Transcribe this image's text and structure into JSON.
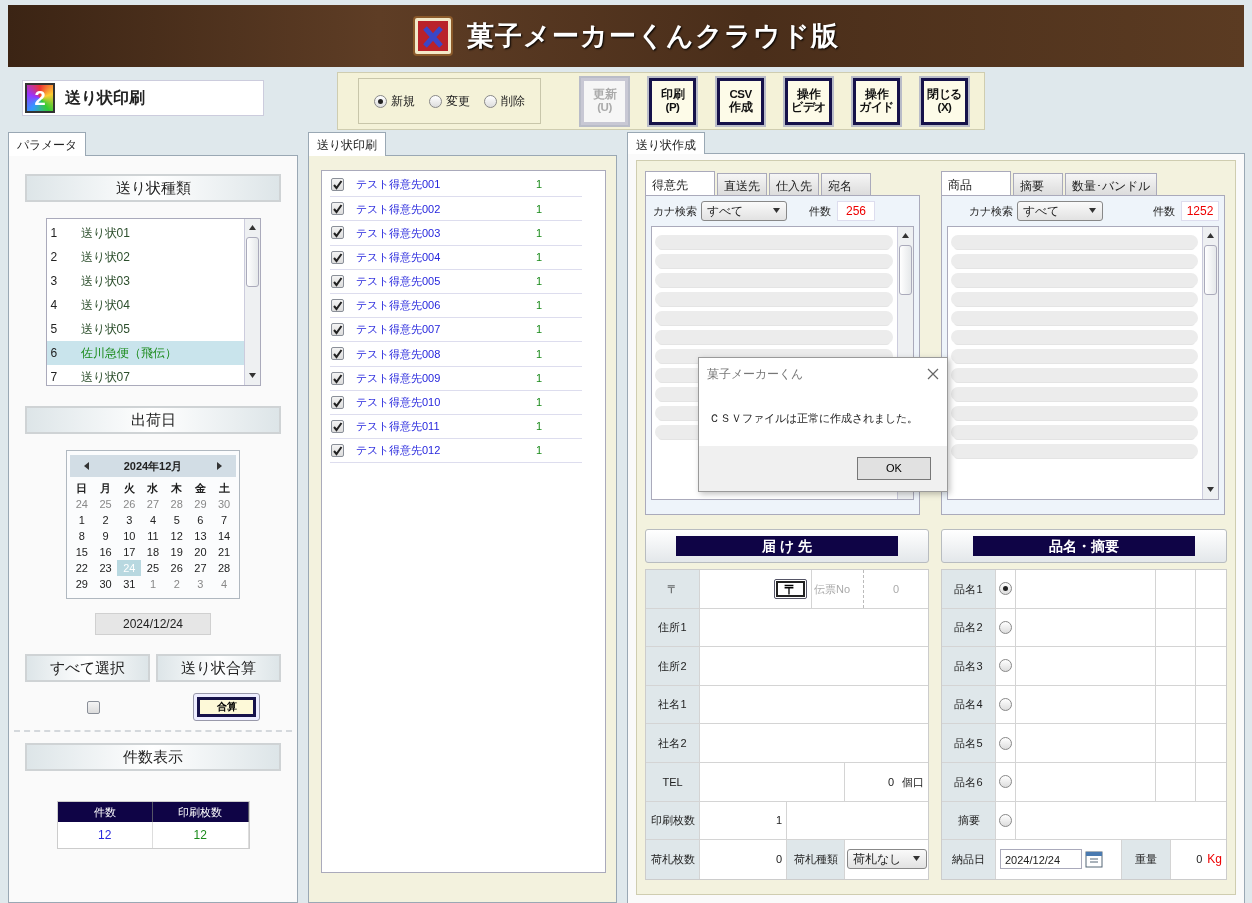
{
  "app_title": "菓子メーカーくんクラウド版",
  "screen_title": {
    "number": "2",
    "label": "送り状印刷"
  },
  "modes": [
    {
      "label": "新規",
      "selected": true
    },
    {
      "label": "変更",
      "selected": false
    },
    {
      "label": "削除",
      "selected": false
    }
  ],
  "toolbar_buttons": [
    {
      "lines": [
        "更新",
        "(U)"
      ],
      "disabled": true
    },
    {
      "lines": [
        "印刷",
        "(P)"
      ],
      "disabled": false
    },
    {
      "lines": [
        "CSV",
        "作成"
      ],
      "disabled": false
    },
    {
      "lines": [
        "操作",
        "ビデオ"
      ],
      "disabled": false
    },
    {
      "lines": [
        "操作",
        "ガイド"
      ],
      "disabled": false
    },
    {
      "lines": [
        "閉じる",
        "(X)"
      ],
      "disabled": false
    }
  ],
  "left_panel": {
    "tab": "パラメータ",
    "invoice_types": {
      "heading": "送り状種類",
      "items": [
        {
          "no": "1",
          "name": "送り状01",
          "selected": false
        },
        {
          "no": "2",
          "name": "送り状02",
          "selected": false
        },
        {
          "no": "3",
          "name": "送り状03",
          "selected": false
        },
        {
          "no": "4",
          "name": "送り状04",
          "selected": false
        },
        {
          "no": "5",
          "name": "送り状05",
          "selected": false
        },
        {
          "no": "6",
          "name": "佐川急便（飛伝）",
          "selected": true
        },
        {
          "no": "7",
          "name": "送り状07",
          "selected": false
        }
      ]
    },
    "ship_date": {
      "heading": "出荷日",
      "month": "2024年12月",
      "weekdays": [
        "日",
        "月",
        "火",
        "水",
        "木",
        "金",
        "土"
      ],
      "weeks": [
        [
          {
            "day": "24",
            "other_month": true,
            "selected": false
          },
          {
            "day": "25",
            "other_month": true,
            "selected": false
          },
          {
            "day": "26",
            "other_month": true,
            "selected": false
          },
          {
            "day": "27",
            "other_month": true,
            "selected": false
          },
          {
            "day": "28",
            "other_month": true,
            "selected": false
          },
          {
            "day": "29",
            "other_month": true,
            "selected": false
          },
          {
            "day": "30",
            "other_month": true,
            "selected": false
          }
        ],
        [
          {
            "day": "1",
            "other_month": false,
            "selected": false
          },
          {
            "day": "2",
            "other_month": false,
            "selected": false
          },
          {
            "day": "3",
            "other_month": false,
            "selected": false
          },
          {
            "day": "4",
            "other_month": false,
            "selected": false
          },
          {
            "day": "5",
            "other_month": false,
            "selected": false
          },
          {
            "day": "6",
            "other_month": false,
            "selected": false
          },
          {
            "day": "7",
            "other_month": false,
            "selected": false
          }
        ],
        [
          {
            "day": "8",
            "other_month": false,
            "selected": false
          },
          {
            "day": "9",
            "other_month": false,
            "selected": false
          },
          {
            "day": "10",
            "other_month": false,
            "selected": false
          },
          {
            "day": "11",
            "other_month": false,
            "selected": false
          },
          {
            "day": "12",
            "other_month": false,
            "selected": false
          },
          {
            "day": "13",
            "other_month": false,
            "selected": false
          },
          {
            "day": "14",
            "other_month": false,
            "selected": false
          }
        ],
        [
          {
            "day": "15",
            "other_month": false,
            "selected": false
          },
          {
            "day": "16",
            "other_month": false,
            "selected": false
          },
          {
            "day": "17",
            "other_month": false,
            "selected": false
          },
          {
            "day": "18",
            "other_month": false,
            "selected": false
          },
          {
            "day": "19",
            "other_month": false,
            "selected": false
          },
          {
            "day": "20",
            "other_month": false,
            "selected": false
          },
          {
            "day": "21",
            "other_month": false,
            "selected": false
          }
        ],
        [
          {
            "day": "22",
            "other_month": false,
            "selected": false
          },
          {
            "day": "23",
            "other_month": false,
            "selected": false
          },
          {
            "day": "24",
            "other_month": false,
            "selected": true
          },
          {
            "day": "25",
            "other_month": false,
            "selected": false
          },
          {
            "day": "26",
            "other_month": false,
            "selected": false
          },
          {
            "day": "27",
            "other_month": false,
            "selected": false
          },
          {
            "day": "28",
            "other_month": false,
            "selected": false
          }
        ],
        [
          {
            "day": "29",
            "other_month": false,
            "selected": false
          },
          {
            "day": "30",
            "other_month": false,
            "selected": false
          },
          {
            "day": "31",
            "other_month": false,
            "selected": false
          },
          {
            "day": "1",
            "other_month": true,
            "selected": false
          },
          {
            "day": "2",
            "other_month": true,
            "selected": false
          },
          {
            "day": "3",
            "other_month": true,
            "selected": false
          },
          {
            "day": "4",
            "other_month": true,
            "selected": false
          }
        ]
      ],
      "value": "2024/12/24"
    },
    "select_all_button": "すべて選択",
    "merge_button": "送り状合算",
    "select_all_checked": false,
    "sum_button": "合算",
    "count_heading": "件数表示",
    "count_columns": [
      "件数",
      "印刷枚数"
    ],
    "count_values": [
      "12",
      "12"
    ]
  },
  "middle_panel": {
    "tab": "送り状印刷",
    "rows": [
      {
        "name": "テスト得意先001",
        "count": "1",
        "checked": true
      },
      {
        "name": "テスト得意先002",
        "count": "1",
        "checked": true
      },
      {
        "name": "テスト得意先003",
        "count": "1",
        "checked": true
      },
      {
        "name": "テスト得意先004",
        "count": "1",
        "checked": true
      },
      {
        "name": "テスト得意先005",
        "count": "1",
        "checked": true
      },
      {
        "name": "テスト得意先006",
        "count": "1",
        "checked": true
      },
      {
        "name": "テスト得意先007",
        "count": "1",
        "checked": true
      },
      {
        "name": "テスト得意先008",
        "count": "1",
        "checked": true
      },
      {
        "name": "テスト得意先009",
        "count": "1",
        "checked": true
      },
      {
        "name": "テスト得意先010",
        "count": "1",
        "checked": true
      },
      {
        "name": "テスト得意先011",
        "count": "1",
        "checked": true
      },
      {
        "name": "テスト得意先012",
        "count": "1",
        "checked": true
      }
    ]
  },
  "right_panel": {
    "tab": "送り状作成",
    "lists": [
      {
        "tabs": [
          {
            "label": "得意先",
            "selected": true
          },
          {
            "label": "直送先",
            "selected": false
          },
          {
            "label": "仕入先",
            "selected": false
          },
          {
            "label": "宛名",
            "selected": false
          }
        ],
        "kana_label": "カナ検索",
        "kana_value": "すべて",
        "count_label": "件数",
        "count": "256"
      },
      {
        "tabs": [
          {
            "label": "商品",
            "selected": true
          },
          {
            "label": "摘要",
            "selected": false
          },
          {
            "label": "数量･バンドル",
            "selected": false
          }
        ],
        "kana_label": "カナ検索",
        "kana_value": "すべて",
        "count_label": "件数",
        "count": "1252"
      }
    ],
    "destination": {
      "heading": "届 け 先",
      "postal_label": "〒",
      "postal_button": "〒",
      "slip_no_label": "伝票No",
      "slip_no": "0",
      "address_rows": [
        "住所1",
        "住所2",
        "社名1",
        "社名2"
      ],
      "tel_label": "TEL",
      "parcels": "0",
      "parcels_unit": "個口",
      "print_count_label": "印刷枚数",
      "print_count": "1",
      "tag_count_label": "荷札枚数",
      "tag_count": "0",
      "tag_type_label": "荷札種類",
      "tag_type": "荷札なし"
    },
    "items": {
      "heading": "品名・摘要",
      "rows": [
        {
          "label": "品名1",
          "kind": "product",
          "selected": true
        },
        {
          "label": "品名2",
          "kind": "product",
          "selected": false
        },
        {
          "label": "品名3",
          "kind": "product",
          "selected": false
        },
        {
          "label": "品名4",
          "kind": "product",
          "selected": false
        },
        {
          "label": "品名5",
          "kind": "product",
          "selected": false
        },
        {
          "label": "品名6",
          "kind": "product",
          "selected": false
        },
        {
          "label": "摘要",
          "kind": "note",
          "selected": false
        }
      ],
      "delivery_label": "納品日",
      "delivery_date": "2024/12/24",
      "weight_label": "重量",
      "weight": "0",
      "weight_unit": "Kg"
    }
  },
  "dialog": {
    "title": "菓子メーカーくん",
    "message": "ＣＳＶファイルは正常に作成されました。",
    "ok": "OK"
  }
}
